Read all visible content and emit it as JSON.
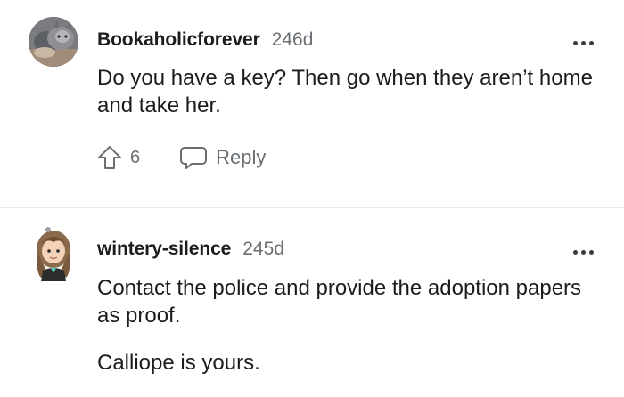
{
  "comments": [
    {
      "author": "Bookaholicforever",
      "age": "246d",
      "paragraphs": [
        "Do you have a key? Then go when they aren’t home and take her."
      ],
      "upvotes": "6",
      "reply_label": "Reply",
      "avatar_icon": "cat-photo-avatar"
    },
    {
      "author": "wintery-silence",
      "age": "245d",
      "paragraphs": [
        "Contact the police and provide the adoption papers as proof.",
        "Calliope is yours."
      ],
      "avatar_icon": "cartoon-girl-avatar"
    }
  ],
  "icons": {
    "upvote": "upvote-arrow-icon",
    "reply": "speech-bubble-icon",
    "more": "more-options-icon"
  },
  "colors": {
    "text": "#1c1c1c",
    "muted": "#6a6f73",
    "divider": "#e9ebed"
  }
}
